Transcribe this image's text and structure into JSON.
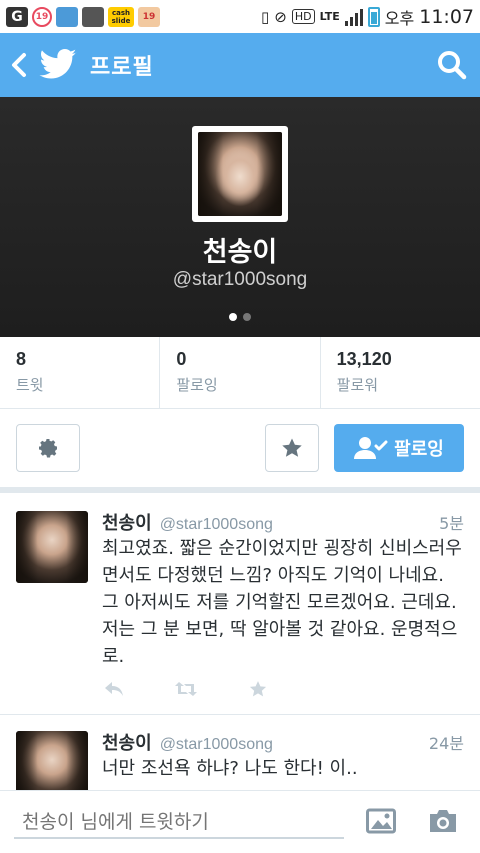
{
  "status_bar": {
    "left_badges": [
      "19",
      "cash slide",
      "19"
    ],
    "network": "LTE",
    "hd": "HD",
    "ampm": "오후",
    "time": "11:07",
    "colors": {
      "battery": "#3aa9d6"
    }
  },
  "action_bar": {
    "title": "프로필",
    "accent": "#55acee"
  },
  "profile": {
    "name": "천송이",
    "handle": "@star1000song"
  },
  "stats": [
    {
      "value": "8",
      "label": "트윗"
    },
    {
      "value": "0",
      "label": "팔로잉"
    },
    {
      "value": "13,120",
      "label": "팔로워"
    }
  ],
  "buttons": {
    "follow_label": "팔로잉"
  },
  "tweets": [
    {
      "name": "천송이",
      "handle": "@star1000song",
      "time": "5분",
      "text": "최고였죠. 짧은 순간이었지만 굉장히 신비스러우면서도 다정했던 느낌? 아직도 기억이 나네요. 그 아저씨도 저를 기억할진 모르겠어요. 근데요. 저는 그 분 보면, 딱 알아볼 것 같아요. 운명적으로."
    },
    {
      "name": "천송이",
      "handle": "@star1000song",
      "time": "24분",
      "text": "너만 조선욕 하냐? 나도 한다! 이.."
    }
  ],
  "compose": {
    "placeholder": "천송이 님에게 트윗하기"
  }
}
